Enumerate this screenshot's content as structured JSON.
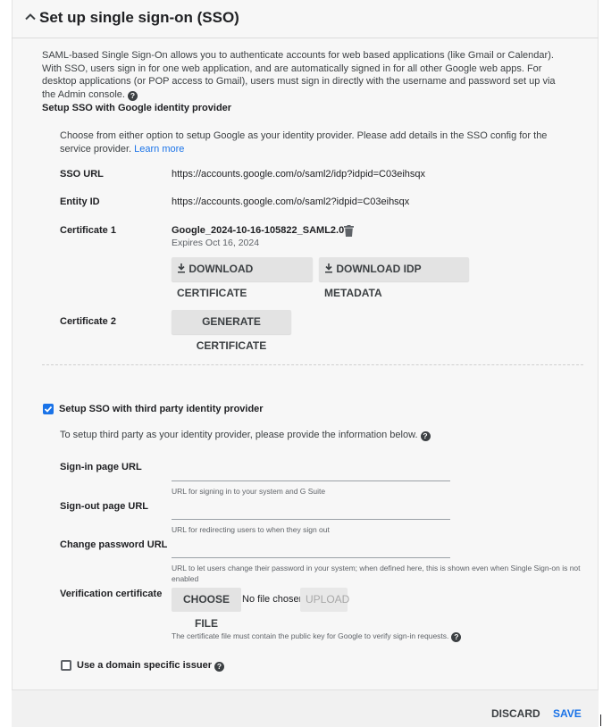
{
  "header": {
    "title": "Set up single sign-on (SSO)"
  },
  "description": "SAML-based Single Sign-On allows you to authenticate accounts for web based applications (like Gmail or Calendar). With SSO, users sign in for one web application, and are automatically signed in for all other Google web apps. For desktop applications (or POP access to Gmail), users must sign in directly with the username and password set up via the Admin console.",
  "google_idp": {
    "heading": "Setup SSO with Google identity provider",
    "intro": "Choose from either option to setup Google as your identity provider. Please add details in the SSO config for the service provider.",
    "learn_more": "Learn more",
    "sso_url_label": "SSO URL",
    "sso_url_value": "https://accounts.google.com/o/saml2/idp?idpid=C03eihsqx",
    "entity_id_label": "Entity ID",
    "entity_id_value": "https://accounts.google.com/o/saml2?idpid=C03eihsqx",
    "cert1_label": "Certificate 1",
    "cert1_name": "Google_2024-10-16-105822_SAML2.0",
    "cert1_expires": "Expires Oct 16, 2024",
    "download_cert": "DOWNLOAD CERTIFICATE",
    "download_idp": "DOWNLOAD IDP METADATA",
    "cert2_label": "Certificate 2",
    "generate_cert": "GENERATE CERTIFICATE"
  },
  "third_party": {
    "checkbox_label": "Setup SSO with third party identity provider",
    "checked": true,
    "intro": "To setup third party as your identity provider, please provide the information below.",
    "signin_label": "Sign-in page URL",
    "signin_value": "",
    "signin_hint": "URL for signing in to your system and G Suite",
    "signout_label": "Sign-out page URL",
    "signout_value": "",
    "signout_hint": "URL for redirecting users to when they sign out",
    "changepw_label": "Change password URL",
    "changepw_value": "",
    "changepw_hint": "URL to let users change their password in your system; when defined here, this is shown even when Single Sign-on is not enabled",
    "verif_label": "Verification certificate",
    "choose_file": "CHOOSE FILE",
    "no_file": "No file chosen",
    "upload": "UPLOAD",
    "cert_hint": "The certificate file must contain the public key for Google to verify sign-in requests.",
    "domain_issuer_label": "Use a domain specific issuer",
    "domain_issuer_checked": false
  },
  "footer": {
    "discard": "DISCARD",
    "save": "SAVE"
  },
  "colors": {
    "accent": "#1a73e8",
    "text": "#202124",
    "muted": "#5f6368"
  }
}
